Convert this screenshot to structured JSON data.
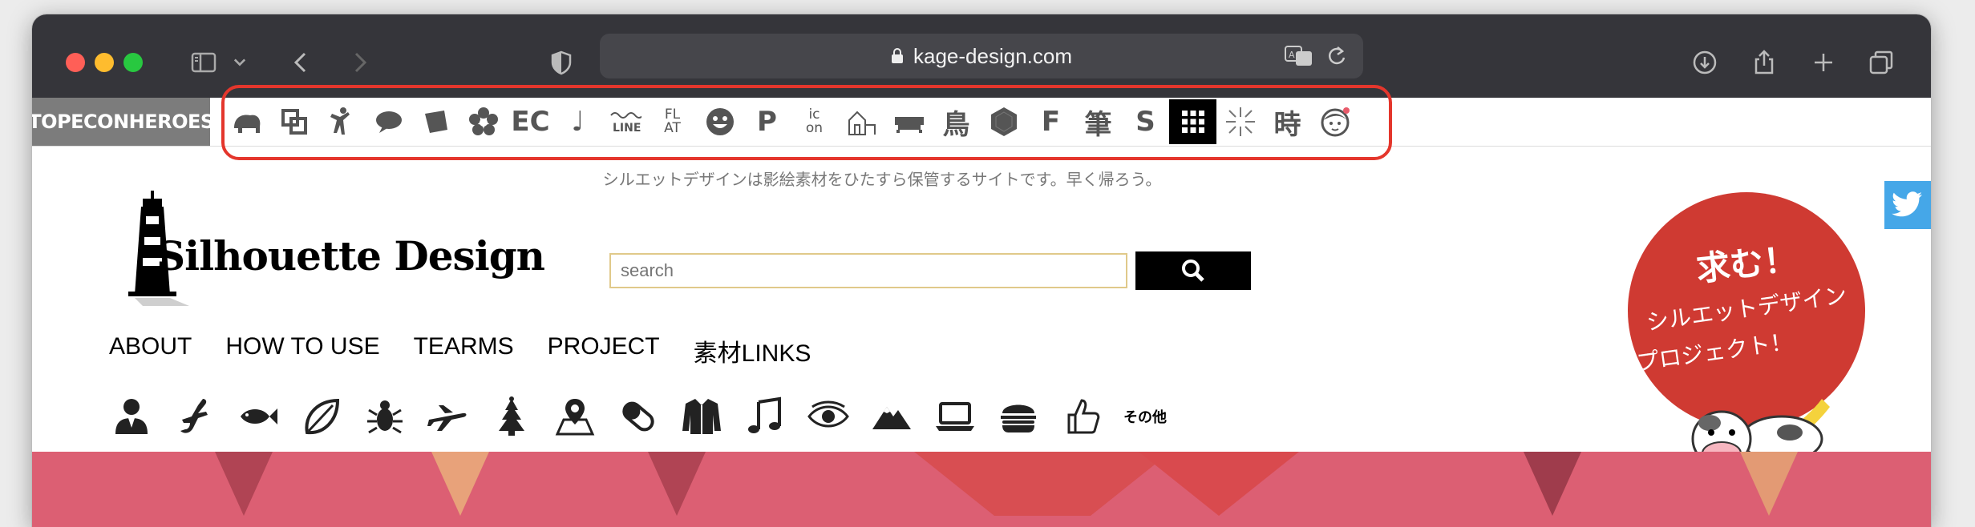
{
  "browser": {
    "url": "kage-design.com"
  },
  "heroes_bar": {
    "logo": "TOPECONHEROES",
    "icons": [
      {
        "name": "elephant-icon",
        "type": "svg"
      },
      {
        "name": "copy-squares-icon",
        "type": "svg"
      },
      {
        "name": "running-person-icon",
        "type": "svg"
      },
      {
        "name": "speech-bubble-icon",
        "type": "svg"
      },
      {
        "name": "flag-icon",
        "type": "svg"
      },
      {
        "name": "flower-icon",
        "type": "svg"
      },
      {
        "name": "ec-icon",
        "type": "text",
        "text": "EC"
      },
      {
        "name": "music-note-icon",
        "type": "text",
        "text": "♩"
      },
      {
        "name": "line-wave-icon",
        "type": "svg"
      },
      {
        "name": "flat-icon",
        "type": "text2",
        "text": "FL\nAT"
      },
      {
        "name": "smiley-icon",
        "type": "svg"
      },
      {
        "name": "parking-icon",
        "type": "text",
        "text": "P"
      },
      {
        "name": "icon-on-icon",
        "type": "text2",
        "text": "ic\non"
      },
      {
        "name": "house-icon",
        "type": "svg"
      },
      {
        "name": "sofa-icon",
        "type": "svg"
      },
      {
        "name": "bird-kanji-icon",
        "type": "text",
        "text": "鳥"
      },
      {
        "name": "hexagon-icon",
        "type": "svg"
      },
      {
        "name": "f-logo-icon",
        "type": "text",
        "text": "F"
      },
      {
        "name": "brush-kanji-icon",
        "type": "text",
        "text": "筆"
      },
      {
        "name": "s-logo-icon",
        "type": "text",
        "text": "S"
      },
      {
        "name": "grid-icon",
        "type": "svg"
      },
      {
        "name": "burst-lines-icon",
        "type": "svg"
      },
      {
        "name": "time-kanji-icon",
        "type": "text",
        "text": "時"
      },
      {
        "name": "face-icon",
        "type": "svg"
      }
    ]
  },
  "site": {
    "tagline": "シルエットデザインは影絵素材をひたすら保管するサイトです。早く帰ろう。",
    "logo_text": "Silhouette Design",
    "search_placeholder": "search",
    "nav": [
      "ABOUT",
      "HOW TO USE",
      "TEARMS",
      "PROJECT",
      "素材LINKS"
    ],
    "categories": [
      "person-icon",
      "lizard-icon",
      "fish-icon",
      "leaf-icon",
      "bug-icon",
      "airplane-icon",
      "christmas-tree-icon",
      "map-pin-icon",
      "pill-icon",
      "jacket-icon",
      "music-notes-icon",
      "eye-icon",
      "mountain-icon",
      "laptop-icon",
      "burger-icon",
      "thumbs-up-icon"
    ],
    "categories_other": "その他",
    "recruit": {
      "line1": "求む！",
      "line2": "シルエットデザイン",
      "line3": "プロジェクト！"
    }
  },
  "colors": {
    "titlebar": "#35353a",
    "highlight_box": "#e4362c",
    "twitter": "#45a7e8",
    "recruit_circle": "#cf3a32",
    "banner": "#dc5f73",
    "search_border": "#e0c98a"
  }
}
